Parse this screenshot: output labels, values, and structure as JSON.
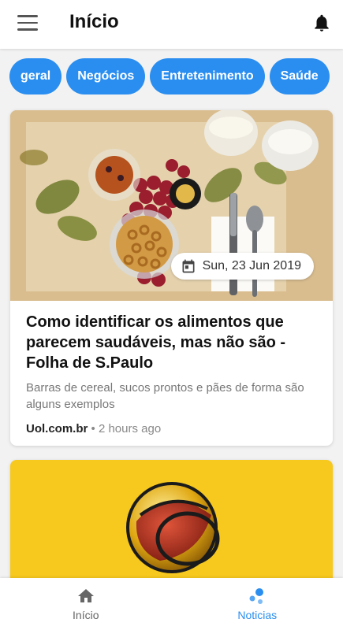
{
  "header": {
    "title": "Início",
    "menu_icon": "hamburger-menu-icon",
    "notification_icon": "bell-icon"
  },
  "chips": [
    {
      "label": "geral"
    },
    {
      "label": "Negócios"
    },
    {
      "label": "Entretenimento"
    },
    {
      "label": "Saúde"
    }
  ],
  "colors": {
    "accent": "#2a8ef0",
    "nav_inactive": "#666666",
    "card2_bg": "#f7c81e"
  },
  "articles": [
    {
      "date": "Sun, 23 Jun 2019",
      "headline": "Como identificar os alimentos que parecem saudáveis, mas não são - Folha de S.Paulo",
      "summary": "Barras de cereal, sucos prontos e pães de forma são alguns exemplos",
      "source": "Uol.com.br",
      "separator": "•",
      "time": "2 hours ago"
    }
  ],
  "bottom_nav": [
    {
      "label": "Início",
      "icon": "home-icon",
      "active": false
    },
    {
      "label": "Noticias",
      "icon": "news-dots-icon",
      "active": true
    }
  ]
}
